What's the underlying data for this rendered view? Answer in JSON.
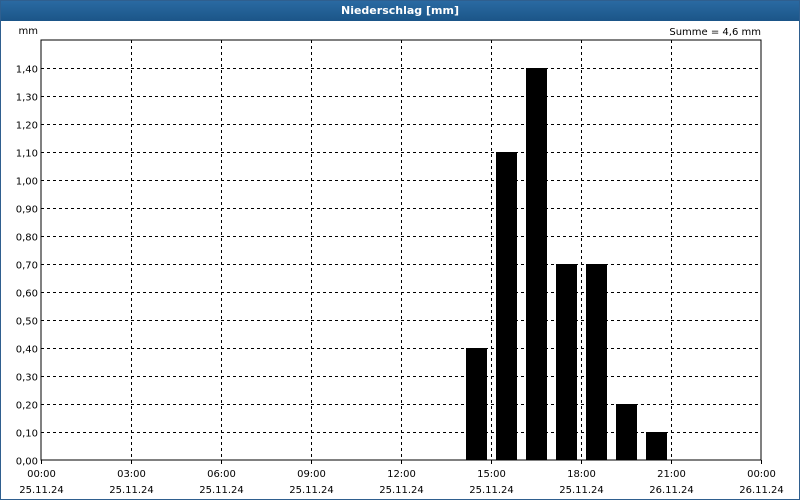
{
  "window": {
    "title": "Niederschlag [mm]"
  },
  "chart_data": {
    "type": "bar",
    "title": "Niederschlag [mm]",
    "ylabel": "mm",
    "annotation": "Summe = 4,6 mm",
    "ylim": [
      0,
      1.5
    ],
    "y_ticks": [
      "0,00",
      "0,10",
      "0,20",
      "0,30",
      "0,40",
      "0,50",
      "0,60",
      "0,70",
      "0,80",
      "0,90",
      "1,00",
      "1,10",
      "1,20",
      "1,30",
      "1,40"
    ],
    "x_range_hours": [
      0,
      24
    ],
    "x_ticks": [
      {
        "time": "00:00",
        "date": "25.11.24"
      },
      {
        "time": "03:00",
        "date": "25.11.24"
      },
      {
        "time": "06:00",
        "date": "25.11.24"
      },
      {
        "time": "09:00",
        "date": "25.11.24"
      },
      {
        "time": "12:00",
        "date": "25.11.24"
      },
      {
        "time": "15:00",
        "date": "25.11.24"
      },
      {
        "time": "18:00",
        "date": "25.11.24"
      },
      {
        "time": "21:00",
        "date": "26.11.24"
      },
      {
        "time": "00:00",
        "date": "26.11.24"
      }
    ],
    "grid": true,
    "bars": [
      {
        "hour": 14,
        "value": 0.4
      },
      {
        "hour": 15,
        "value": 1.1
      },
      {
        "hour": 16,
        "value": 1.4
      },
      {
        "hour": 17,
        "value": 0.7
      },
      {
        "hour": 18,
        "value": 0.7
      },
      {
        "hour": 19,
        "value": 0.2
      },
      {
        "hour": 20,
        "value": 0.1
      }
    ],
    "bar_color": "#000000"
  }
}
